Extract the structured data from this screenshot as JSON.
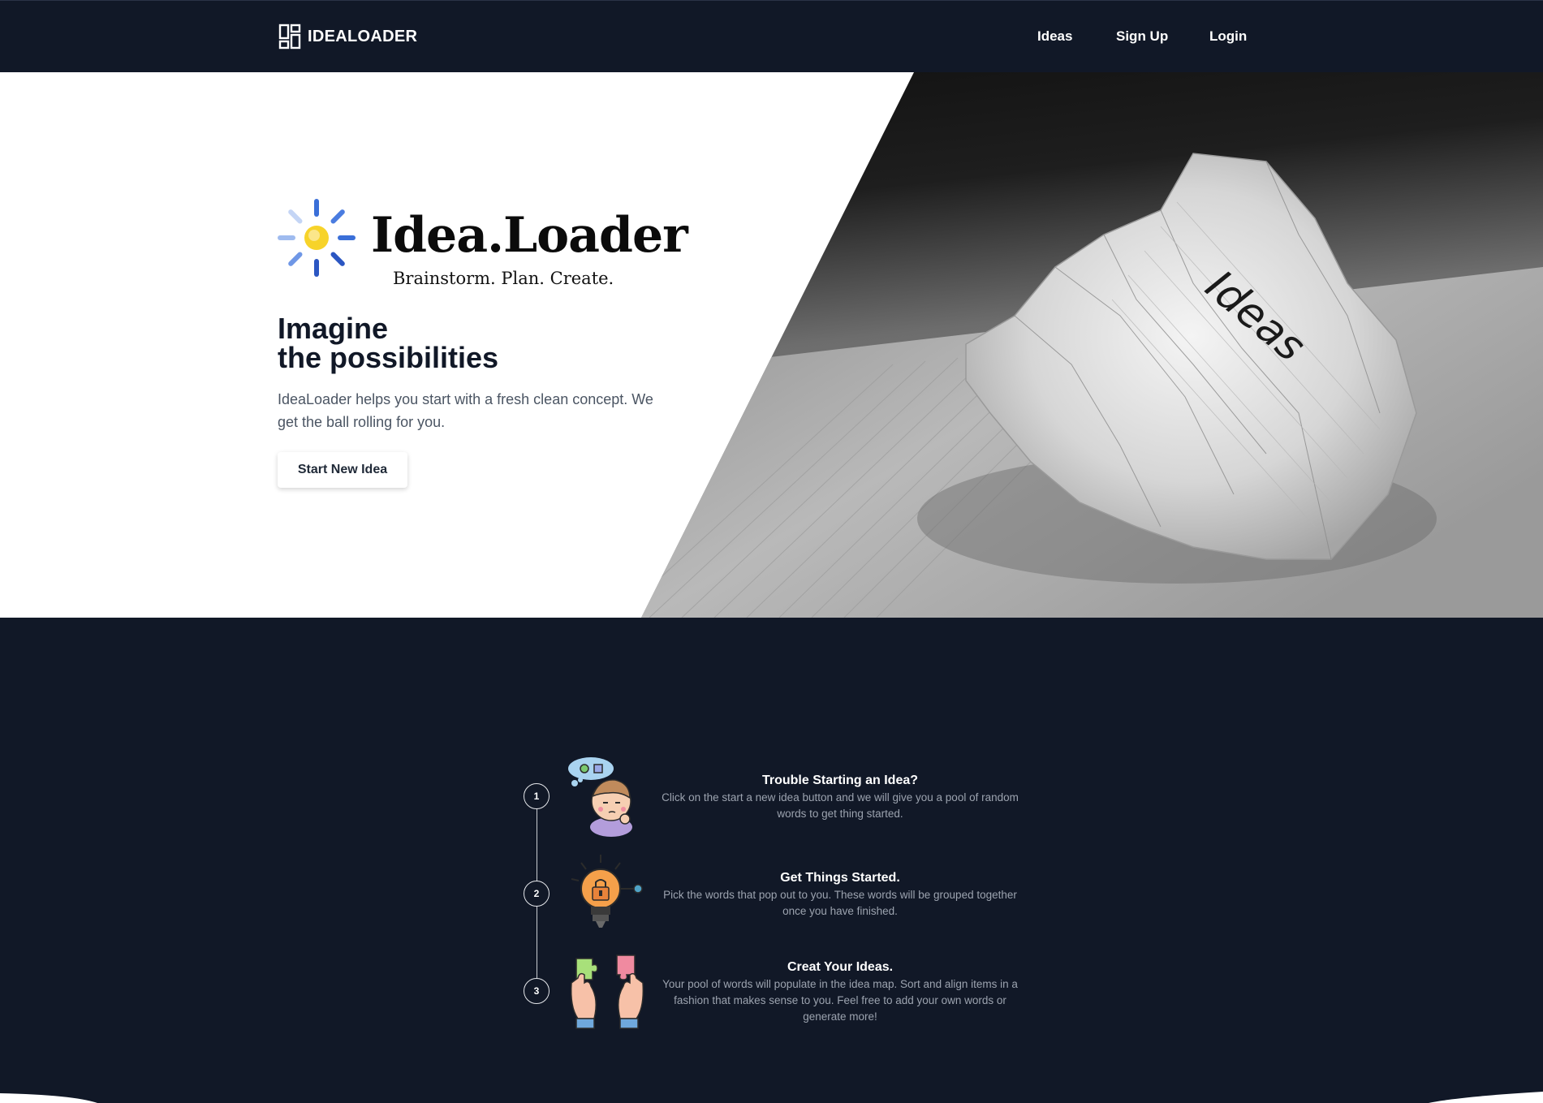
{
  "nav": {
    "brand": "IDEALOADER",
    "brand_icon": "dashboard-grid-icon",
    "links": [
      "Ideas",
      "Sign Up",
      "Login"
    ]
  },
  "hero": {
    "logo_word": "Idea.Loader",
    "logo_tagline": "Brainstorm. Plan. Create.",
    "logo_icon": "sun-loader-icon",
    "title_line1": "Imagine",
    "title_line2": "the possibilities",
    "description": "IdeaLoader helps you start with a fresh clean concept. We get the ball rolling for you.",
    "cta": "Start New Idea",
    "photo_text": "Ideas",
    "photo_icon": "crumpled-paper-photo"
  },
  "steps": [
    {
      "number": "1",
      "icon": "thinking-person-icon",
      "title": "Trouble Starting an Idea?",
      "description": "Click on the start a new idea button and we will give you a pool of random words to get thing started."
    },
    {
      "number": "2",
      "icon": "lightbulb-lock-icon",
      "title": "Get Things Started.",
      "description": "Pick the words that pop out to you. These words will be grouped together once you have finished."
    },
    {
      "number": "3",
      "icon": "puzzle-hands-icon",
      "title": "Creat Your Ideas.",
      "description": "Your pool of words will populate in the idea map. Sort and align items in a fashion that makes sense to you. Feel free to add your own words or generate more!"
    }
  ],
  "colors": {
    "dark": "#111827",
    "text_muted": "#9ca3af",
    "white": "#ffffff"
  }
}
